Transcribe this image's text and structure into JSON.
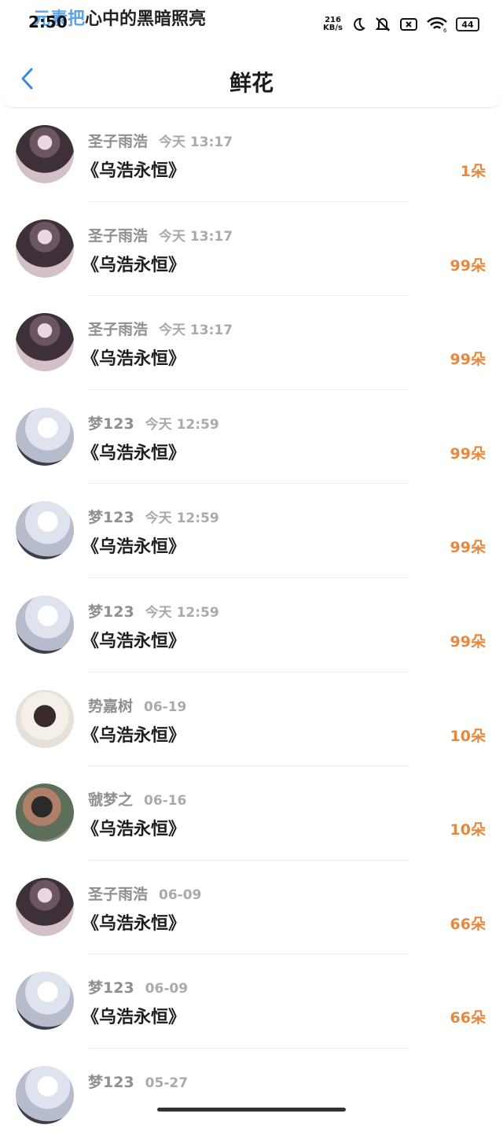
{
  "status_bar": {
    "time": "2:50",
    "marquee_blue": "元素把",
    "marquee_dark": "心中的黑暗照亮",
    "net_speed_value": "216",
    "net_speed_unit": "KB/s",
    "battery": "44",
    "icons": [
      "moon-icon",
      "mute-icon",
      "sim-off-icon",
      "wifi-icon",
      "battery-icon"
    ]
  },
  "header": {
    "title": "鲜花",
    "back_icon": "chevron-left-icon",
    "accent": "#3a8be0"
  },
  "list": [
    {
      "name": "圣子雨浩",
      "time": "今天 13:17",
      "text": "《乌浩永恒》",
      "count": "1朵",
      "avatar": "a"
    },
    {
      "name": "圣子雨浩",
      "time": "今天 13:17",
      "text": "《乌浩永恒》",
      "count": "99朵",
      "avatar": "a"
    },
    {
      "name": "圣子雨浩",
      "time": "今天 13:17",
      "text": "《乌浩永恒》",
      "count": "99朵",
      "avatar": "a"
    },
    {
      "name": "梦123",
      "time": "今天 12:59",
      "text": "《乌浩永恒》",
      "count": "99朵",
      "avatar": "b"
    },
    {
      "name": "梦123",
      "time": "今天 12:59",
      "text": "《乌浩永恒》",
      "count": "99朵",
      "avatar": "b"
    },
    {
      "name": "梦123",
      "time": "今天 12:59",
      "text": "《乌浩永恒》",
      "count": "99朵",
      "avatar": "b"
    },
    {
      "name": "势嘉树",
      "time": "06-19",
      "text": "《乌浩永恒》",
      "count": "10朵",
      "avatar": "c"
    },
    {
      "name": "虢梦之",
      "time": "06-16",
      "text": "《乌浩永恒》",
      "count": "10朵",
      "avatar": "d"
    },
    {
      "name": "圣子雨浩",
      "time": "06-09",
      "text": "《乌浩永恒》",
      "count": "66朵",
      "avatar": "a"
    },
    {
      "name": "梦123",
      "time": "06-09",
      "text": "《乌浩永恒》",
      "count": "66朵",
      "avatar": "b"
    },
    {
      "name": "梦123",
      "time": "05-27",
      "text": "",
      "count": "",
      "avatar": "b"
    }
  ],
  "colors": {
    "count": "#e8883c",
    "name": "#8f8f8f",
    "accent": "#3a8be0"
  }
}
